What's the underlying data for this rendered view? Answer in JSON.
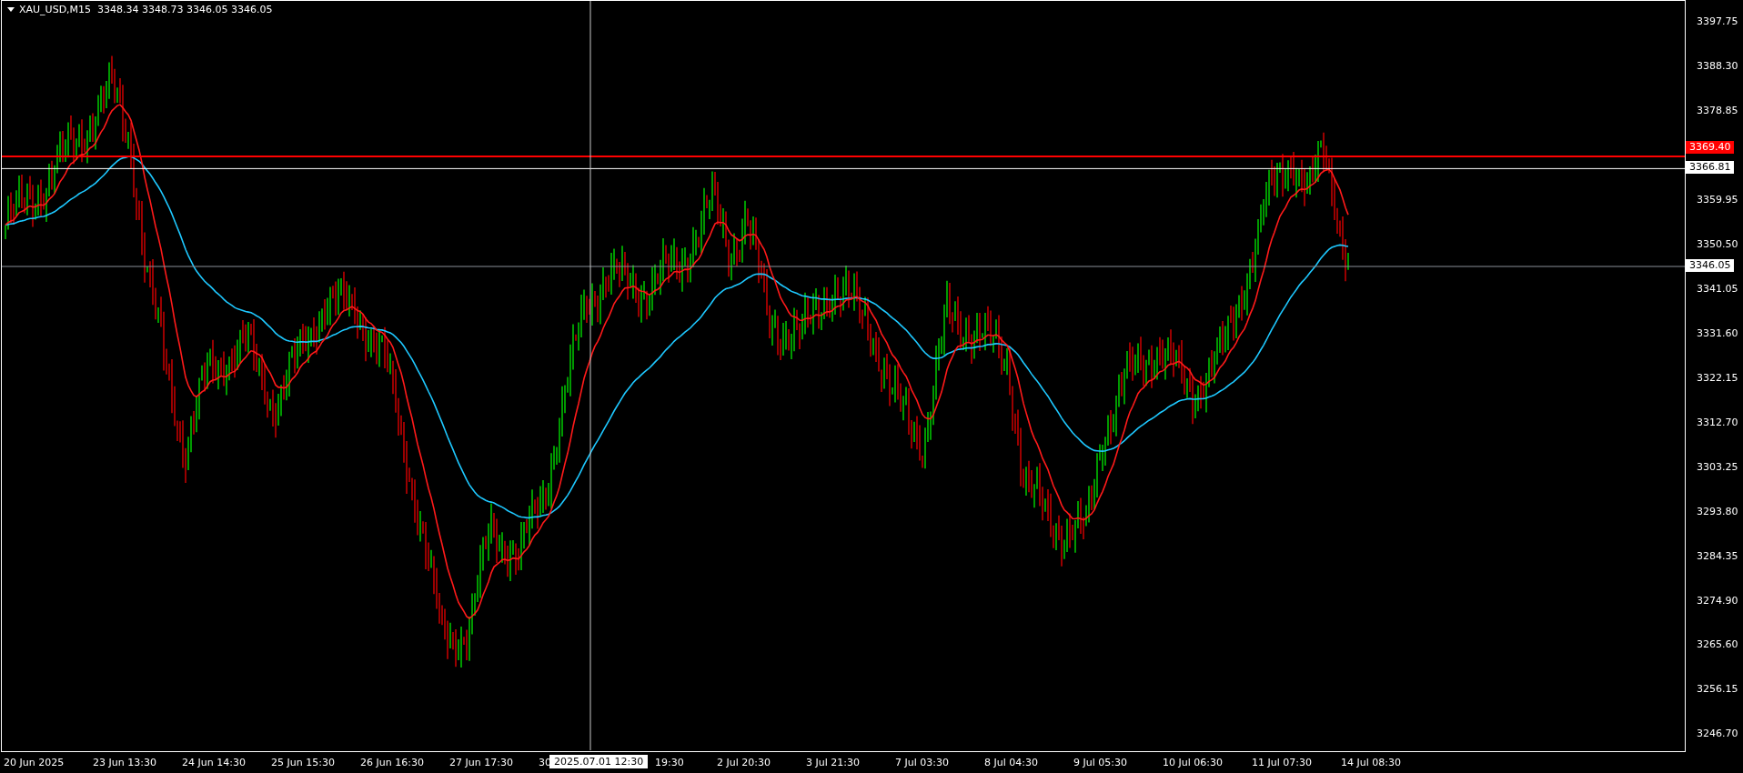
{
  "chart": {
    "header": "XAU_USD,M15  3348.34 3348.73 3346.05 3346.05",
    "price_axis": [
      "3397.75",
      "3388.30",
      "3378.85",
      "3359.95",
      "3350.50",
      "3341.05",
      "3331.60",
      "3322.15",
      "3312.70",
      "3303.25",
      "3293.80",
      "3284.35",
      "3274.90",
      "3265.60",
      "3256.15",
      "3246.70"
    ],
    "price_labels": [
      {
        "kind": "alert",
        "text": "3369.40"
      },
      {
        "kind": "crosshair",
        "text": "3366.81"
      },
      {
        "kind": "bid",
        "text": "3346.05"
      }
    ],
    "time_axis": [
      "20 Jun 2025",
      "23 Jun 13:30",
      "24 Jun 14:30",
      "25 Jun 15:30",
      "26 Jun 16:30",
      "27 Jun 17:30",
      "30",
      "19:30",
      "2 Jul 20:30",
      "3 Jul 21:30",
      "7 Jul 03:30",
      "8 Jul 04:30",
      "9 Jul 05:30",
      "10 Jul 06:30",
      "11 Jul 07:30",
      "14 Jul 08:30"
    ],
    "crosshair_time": "2025.07.01 12:30"
  }
}
